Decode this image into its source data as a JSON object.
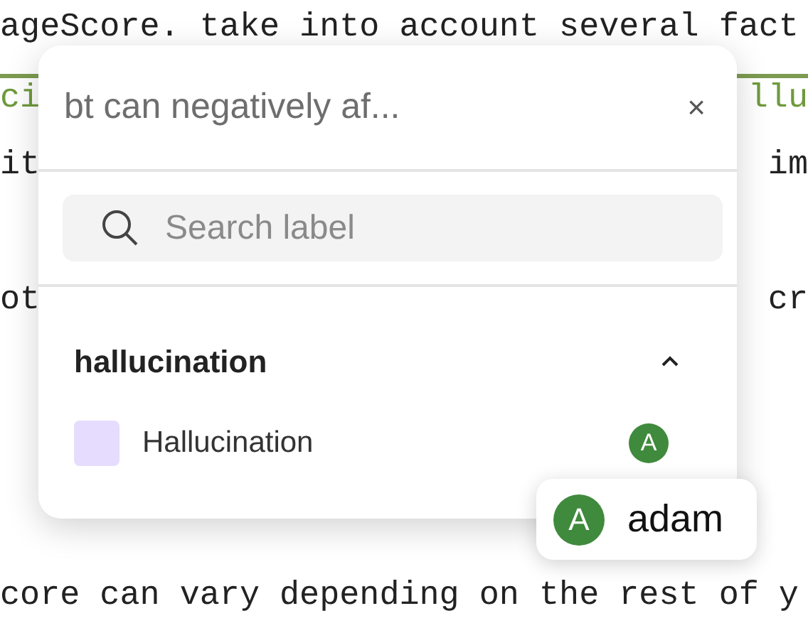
{
  "document": {
    "lines": [
      {
        "kind": "full",
        "text": "ageScore. take into account several fact"
      },
      {
        "kind": "label",
        "left": "ci",
        "right": "llu"
      },
      {
        "kind": "split",
        "left": "it",
        "right": "im"
      },
      {
        "kind": "split",
        "left": "ot",
        "right": "cr"
      },
      {
        "kind": "full",
        "text": "core can vary depending on the rest of y"
      }
    ]
  },
  "popup": {
    "title": "bt can negatively af...",
    "close": "×",
    "search": {
      "placeholder": "Search label"
    },
    "groups": [
      {
        "name": "hallucination",
        "expanded": true,
        "labels": [
          {
            "name": "Hallucination",
            "color": "#e6dcfd",
            "annotators": [
              "A"
            ]
          }
        ]
      }
    ]
  },
  "tooltip": {
    "initial": "A",
    "user": "adam"
  }
}
